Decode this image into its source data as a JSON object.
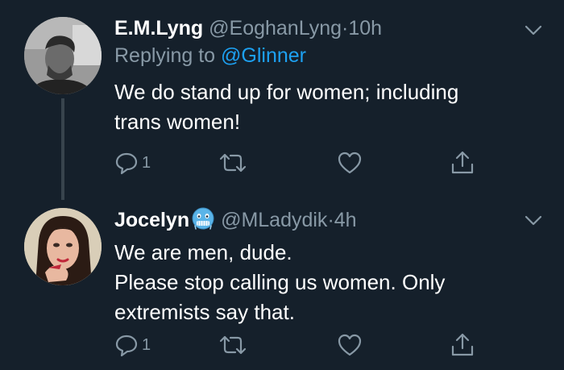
{
  "tweets": [
    {
      "name": "E.M.Lyng",
      "handle": "@EoghanLyng",
      "separator": "·",
      "time": "10h",
      "reply_prefix": "Replying to",
      "reply_to": "@Glinner",
      "text_lines": [
        "We do stand up for women; including",
        "trans women!"
      ],
      "reply_count": "1",
      "avatar_icon": "user-photo-avatar"
    },
    {
      "name": "Jocelyn",
      "name_emoji": "cold-face-emoji",
      "handle": "@MLadydik",
      "separator": "·",
      "time": "4h",
      "text_lines": [
        "We are men, dude.",
        "Please stop calling us women. Only",
        "extremists say that."
      ],
      "reply_count": "1",
      "avatar_icon": "illustrated-woman-avatar"
    }
  ],
  "colors": {
    "background": "#15202b",
    "text": "#ffffff",
    "muted": "#8899a6",
    "link": "#1da1f2",
    "thread_line": "#38444d"
  }
}
